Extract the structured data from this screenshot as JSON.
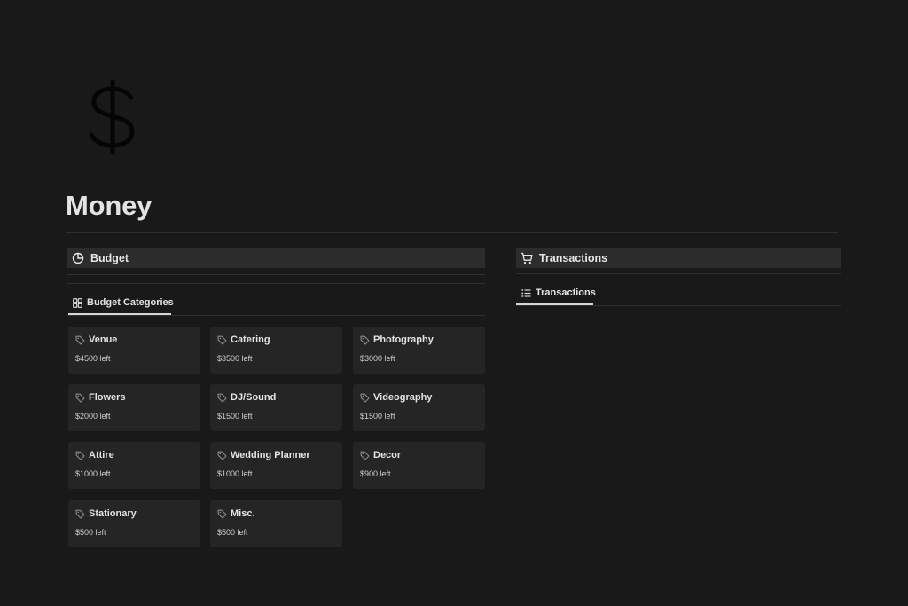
{
  "page": {
    "title": "Money",
    "icon": "dollar-sign-icon"
  },
  "budget": {
    "header": "Budget",
    "header_icon": "pie-chart-icon",
    "view_tab": "Budget Categories",
    "view_tab_icon": "gallery-grid-icon",
    "categories": [
      {
        "name": "Venue",
        "amount": "$4500 left"
      },
      {
        "name": "Catering",
        "amount": "$3500 left"
      },
      {
        "name": "Photography",
        "amount": "$3000 left"
      },
      {
        "name": "Flowers",
        "amount": "$2000 left"
      },
      {
        "name": "DJ/Sound",
        "amount": "$1500 left"
      },
      {
        "name": "Videography",
        "amount": "$1500 left"
      },
      {
        "name": "Attire",
        "amount": "$1000 left"
      },
      {
        "name": "Wedding Planner",
        "amount": "$1000 left"
      },
      {
        "name": "Decor",
        "amount": "$900 left"
      },
      {
        "name": "Stationary",
        "amount": "$500 left"
      },
      {
        "name": "Misc.",
        "amount": "$500 left"
      }
    ]
  },
  "transactions": {
    "header": "Transactions",
    "header_icon": "shopping-cart-icon",
    "view_tab": "Transactions",
    "view_tab_icon": "list-icon"
  },
  "colors": {
    "background": "#191919",
    "card": "#252525",
    "header_bar": "#2c2c2c"
  }
}
